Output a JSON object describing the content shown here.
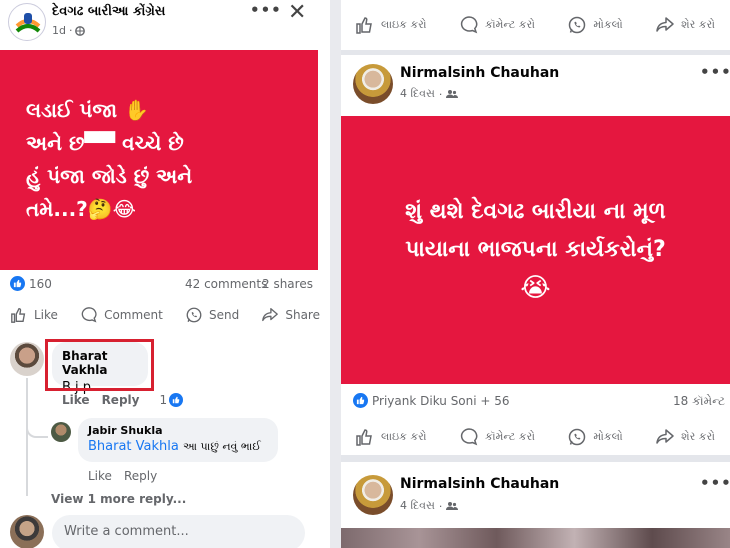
{
  "left_post": {
    "page_name": "દેવગઢ બારીઆ કોંગ્રેસ",
    "time": "1d",
    "image_lines": [
      "લડાઈ પંજા ✋",
      "અને છ▀▀ વચ્ચે છે",
      "હું પંજા જોડે છું અને",
      "તમે...?🤔😂"
    ],
    "reaction_count": "160",
    "comments_count": "42 comments",
    "shares_count": "2 shares",
    "actions": {
      "like": "Like",
      "comment": "Comment",
      "send": "Send",
      "share": "Share"
    },
    "comments": [
      {
        "name": "Bharat Vakhla",
        "text": "B.j.p",
        "like": "Like",
        "reply": "Reply",
        "reacts": "1"
      },
      {
        "name": "Jabir Shukla",
        "mention": "Bharat Vakhla",
        "text": "આ પાછું નવું ભાઈ",
        "like": "Like",
        "reply": "Reply"
      }
    ],
    "view_more": "View 1 more reply...",
    "write_placeholder": "Write a comment..."
  },
  "right_feed": {
    "top_actions": {
      "like": "લાઇક કરો",
      "comment": "કૉમેન્ટ કરો",
      "send": "મોકલો",
      "share": "શેર કરો"
    },
    "post1": {
      "poster": "Nirmalsinh Chauhan",
      "time": "4 દિવસ",
      "image_lines": [
        "શું થશે દેવગઢ બારીયા ના મૂળ",
        "પાયાના ભાજપના કાર્યકરોનું?",
        "😭"
      ],
      "reactors": "Priyank Diku Soni + 56",
      "comments": "18 કૉમેન્ટ",
      "actions": {
        "like": "લાઇક કરો",
        "comment": "કૉમેન્ટ કરો",
        "send": "મોકલો",
        "share": "શેર કરો"
      }
    },
    "post2": {
      "poster": "Nirmalsinh Chauhan",
      "time": "4 દિવસ"
    }
  },
  "colors": {
    "post_red": "#e5173f",
    "fb_blue": "#1877f2",
    "highlight": "#d72030"
  }
}
